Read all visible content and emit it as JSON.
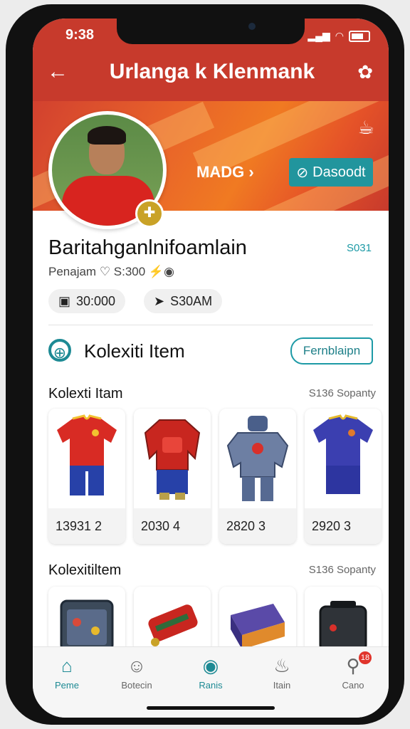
{
  "status_bar": {
    "time": "9:38",
    "signal": "▂▄▆",
    "wifi": "◠"
  },
  "header": {
    "title": "Urlanga k Klenmank",
    "back_glyph": "←",
    "menu_glyph": "✿"
  },
  "banner": {
    "made_label": "MADG",
    "made_chevron": "›",
    "follow_label": "Dasoodt",
    "follow_icon": "⊘",
    "corner_icon": "☕︎"
  },
  "profile": {
    "name": "Baritahganlnifoamlain",
    "code": "S031",
    "meta": "Penajam ♡ S:300 ⚡◉",
    "chips": [
      {
        "icon": "▣",
        "label": "30:000"
      },
      {
        "icon": "➤",
        "label": "S30AM"
      }
    ]
  },
  "section": {
    "icon": "⊕",
    "title": "Kolexiti Item",
    "button_label": "Fernblaipn"
  },
  "row1": {
    "title": "Kolexti Itam",
    "count": "S136 Sopanty",
    "items": [
      {
        "price": "13931 2"
      },
      {
        "price": "2030 4"
      },
      {
        "price": "2820 3"
      },
      {
        "price": "2920 3"
      }
    ]
  },
  "row2": {
    "title": "Kolexitiltem",
    "count": "S136 Sopanty"
  },
  "tabbar": {
    "tabs": [
      {
        "label": "Peme",
        "icon": "⌂"
      },
      {
        "label": "Botecin",
        "icon": "☺"
      },
      {
        "label": "Ranis",
        "icon": "◉"
      },
      {
        "label": "Itain",
        "icon": "♨"
      },
      {
        "label": "Cano",
        "icon": "⚲",
        "badge": "18"
      }
    ]
  },
  "colors": {
    "accent": "#1d9aa6",
    "header": "#c73a2c",
    "badge": "#e0342b"
  }
}
